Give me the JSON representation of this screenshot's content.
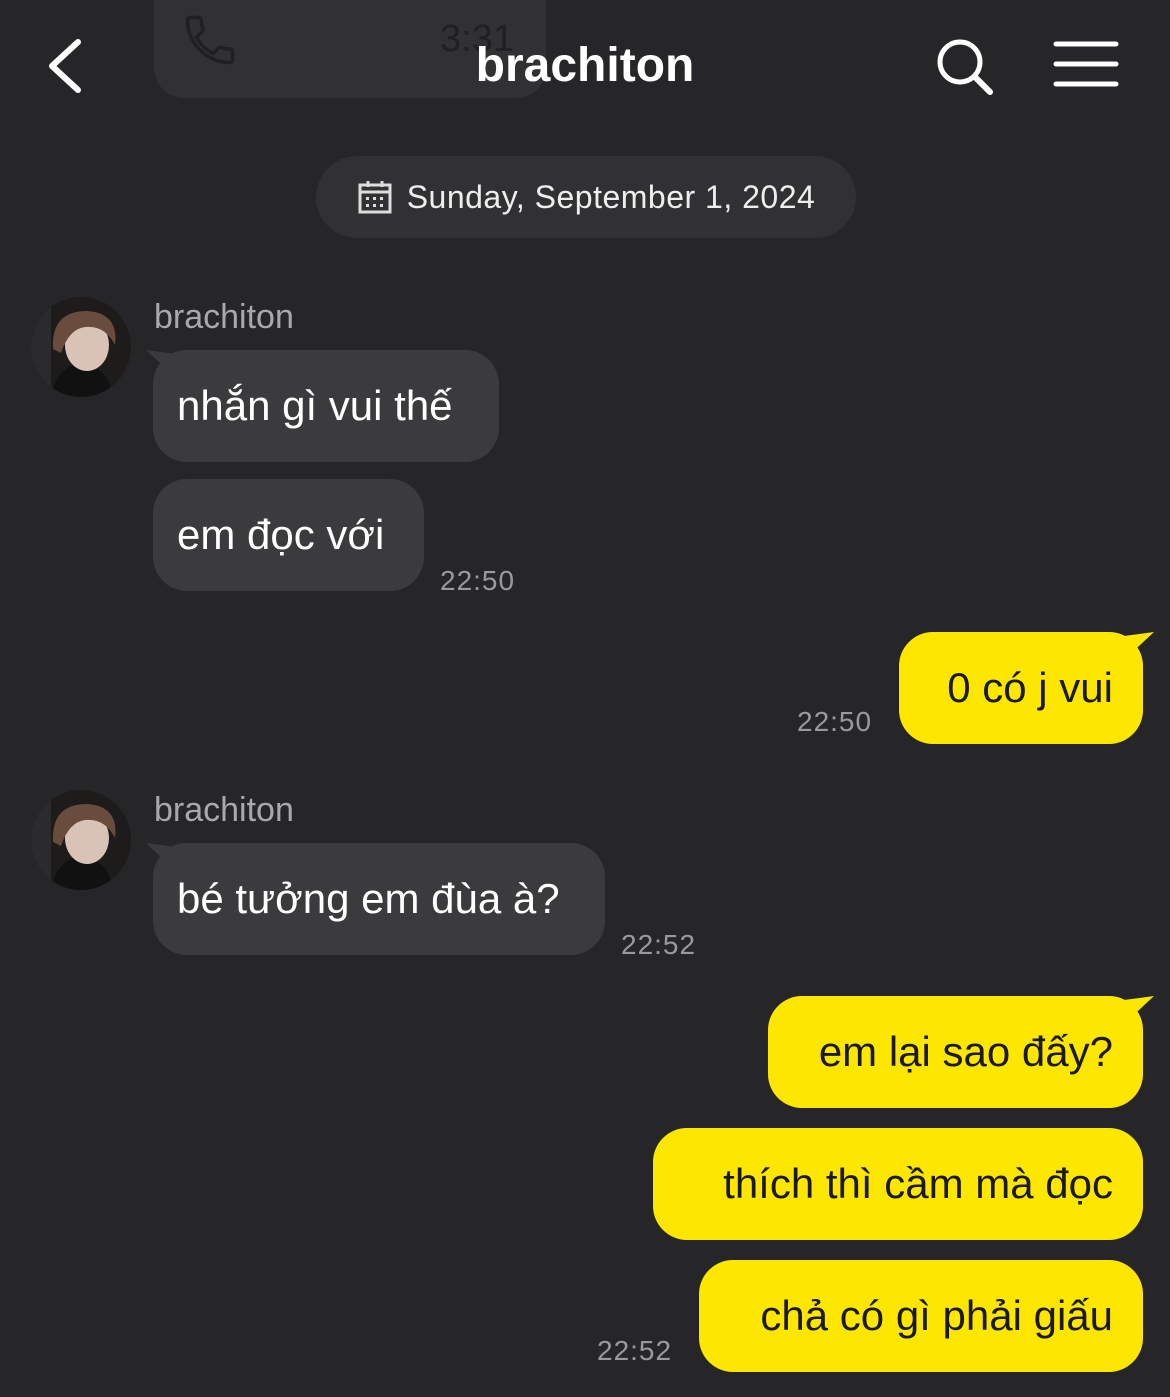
{
  "header": {
    "title": "brachiton",
    "back_icon": "chevron-left-icon",
    "search_icon": "search-icon",
    "menu_icon": "hamburger-menu-icon"
  },
  "previous_call": {
    "duration": "3:31",
    "icon": "phone-icon"
  },
  "date_divider": {
    "icon": "calendar-icon",
    "label": "Sunday, September 1, 2024"
  },
  "messages": [
    {
      "type": "incoming",
      "sender": "brachiton",
      "bubbles": [
        "nhắn gì vui thế",
        "em đọc với"
      ],
      "time": "22:50"
    },
    {
      "type": "outgoing",
      "bubbles": [
        "0 có j vui"
      ],
      "time": "22:50"
    },
    {
      "type": "incoming",
      "sender": "brachiton",
      "bubbles": [
        "bé tưởng em đùa à?"
      ],
      "time": "22:52"
    },
    {
      "type": "outgoing",
      "bubbles": [
        "em lại sao đấy?",
        "thích thì cầm mà đọc",
        "chả có gì phải giấu"
      ],
      "time": "22:52"
    }
  ],
  "colors": {
    "background": "#262628",
    "incoming_bubble": "#3b3b3d",
    "outgoing_bubble": "#fde600",
    "timestamp": "#9a9a9c"
  }
}
